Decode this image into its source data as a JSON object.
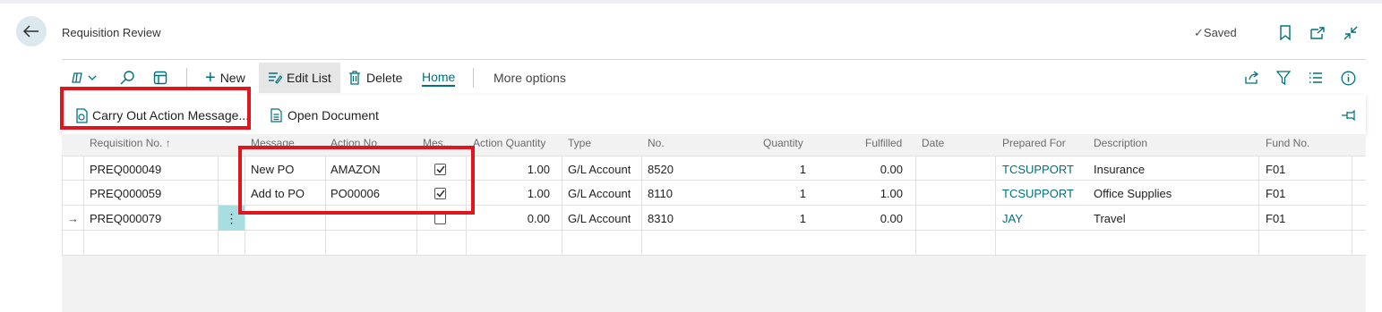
{
  "header": {
    "title": "Requisition Review",
    "saved_label": "Saved"
  },
  "toolbar": {
    "new_label": "New",
    "edit_list_label": "Edit List",
    "delete_label": "Delete",
    "home_label": "Home",
    "more_options_label": "More options"
  },
  "actions": {
    "carry_out_label": "Carry Out Action Message...",
    "open_document_label": "Open Document"
  },
  "columns": {
    "requisition_no": "Requisition No. ↑",
    "message": "Message",
    "action_no": "Action No.",
    "mes": "Mes...",
    "action_quantity": "Action Quantity",
    "type": "Type",
    "no": "No.",
    "quantity": "Quantity",
    "fulfilled": "Fulfilled",
    "date": "Date",
    "prepared_for": "Prepared For",
    "description": "Description",
    "fund_no": "Fund No."
  },
  "rows": [
    {
      "req_no": "PREQ000049",
      "message": "New PO",
      "action_no": "AMAZON",
      "checked": true,
      "action_qty": "1.00",
      "type": "G/L Account",
      "no": "8520",
      "quantity": "1",
      "fulfilled": "0.00",
      "date": "",
      "prepared_for": "TCSUPPORT",
      "description": "Insurance",
      "fund_no": "F01"
    },
    {
      "req_no": "PREQ000059",
      "message": "Add to PO",
      "action_no": "PO00006",
      "checked": true,
      "action_qty": "1.00",
      "type": "G/L Account",
      "no": "8110",
      "quantity": "1",
      "fulfilled": "1.00",
      "date": "",
      "prepared_for": "TCSUPPORT",
      "description": "Office Supplies",
      "fund_no": "F01"
    },
    {
      "req_no": "PREQ000079",
      "message": "",
      "action_no": "",
      "checked": false,
      "action_qty": "0.00",
      "type": "G/L Account",
      "no": "8310",
      "quantity": "1",
      "fulfilled": "0.00",
      "date": "",
      "prepared_for": "JAY",
      "description": "Travel",
      "fund_no": "F01"
    }
  ],
  "row_menu_glyph": "⋮",
  "row_pointer_glyph": "→",
  "colors": {
    "accent": "#00707a",
    "highlight_box": "#e0161e",
    "selected_cell": "#a8dde2"
  }
}
